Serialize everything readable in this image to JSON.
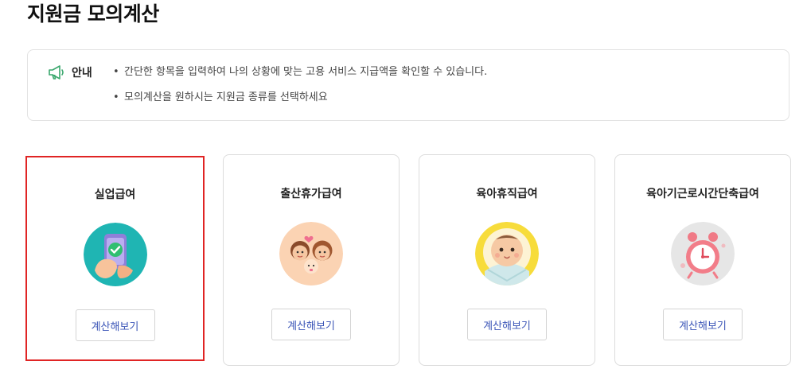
{
  "page": {
    "title": "지원금 모의계산"
  },
  "notice": {
    "label": "안내",
    "icon": "megaphone-icon",
    "accent": "#3aa76d",
    "items": [
      "간단한 항목을 입력하여 나의 상황에 맞는 고용 서비스 지급액을 확인할 수 있습니다.",
      "모의계산을 원하시는 지원금 종류를 선택하세요"
    ]
  },
  "cards": [
    {
      "title": "실업급여",
      "button_label": "계산해보기",
      "selected": true,
      "illustration": "phone-check-hand-icon",
      "bg_color": "#1fb5b3"
    },
    {
      "title": "출산휴가급여",
      "button_label": "계산해보기",
      "selected": false,
      "illustration": "parents-baby-icon",
      "bg_color": "#fbd3b3"
    },
    {
      "title": "육아휴직급여",
      "button_label": "계산해보기",
      "selected": false,
      "illustration": "baby-face-icon",
      "bg_color": "#f7dc3b"
    },
    {
      "title": "육아기근로시간단축급여",
      "button_label": "계산해보기",
      "selected": false,
      "illustration": "alarm-clock-icon",
      "bg_color": "#e6e6e6"
    }
  ],
  "colors": {
    "selected_border": "#e02424",
    "button_text": "#3b55b7"
  }
}
